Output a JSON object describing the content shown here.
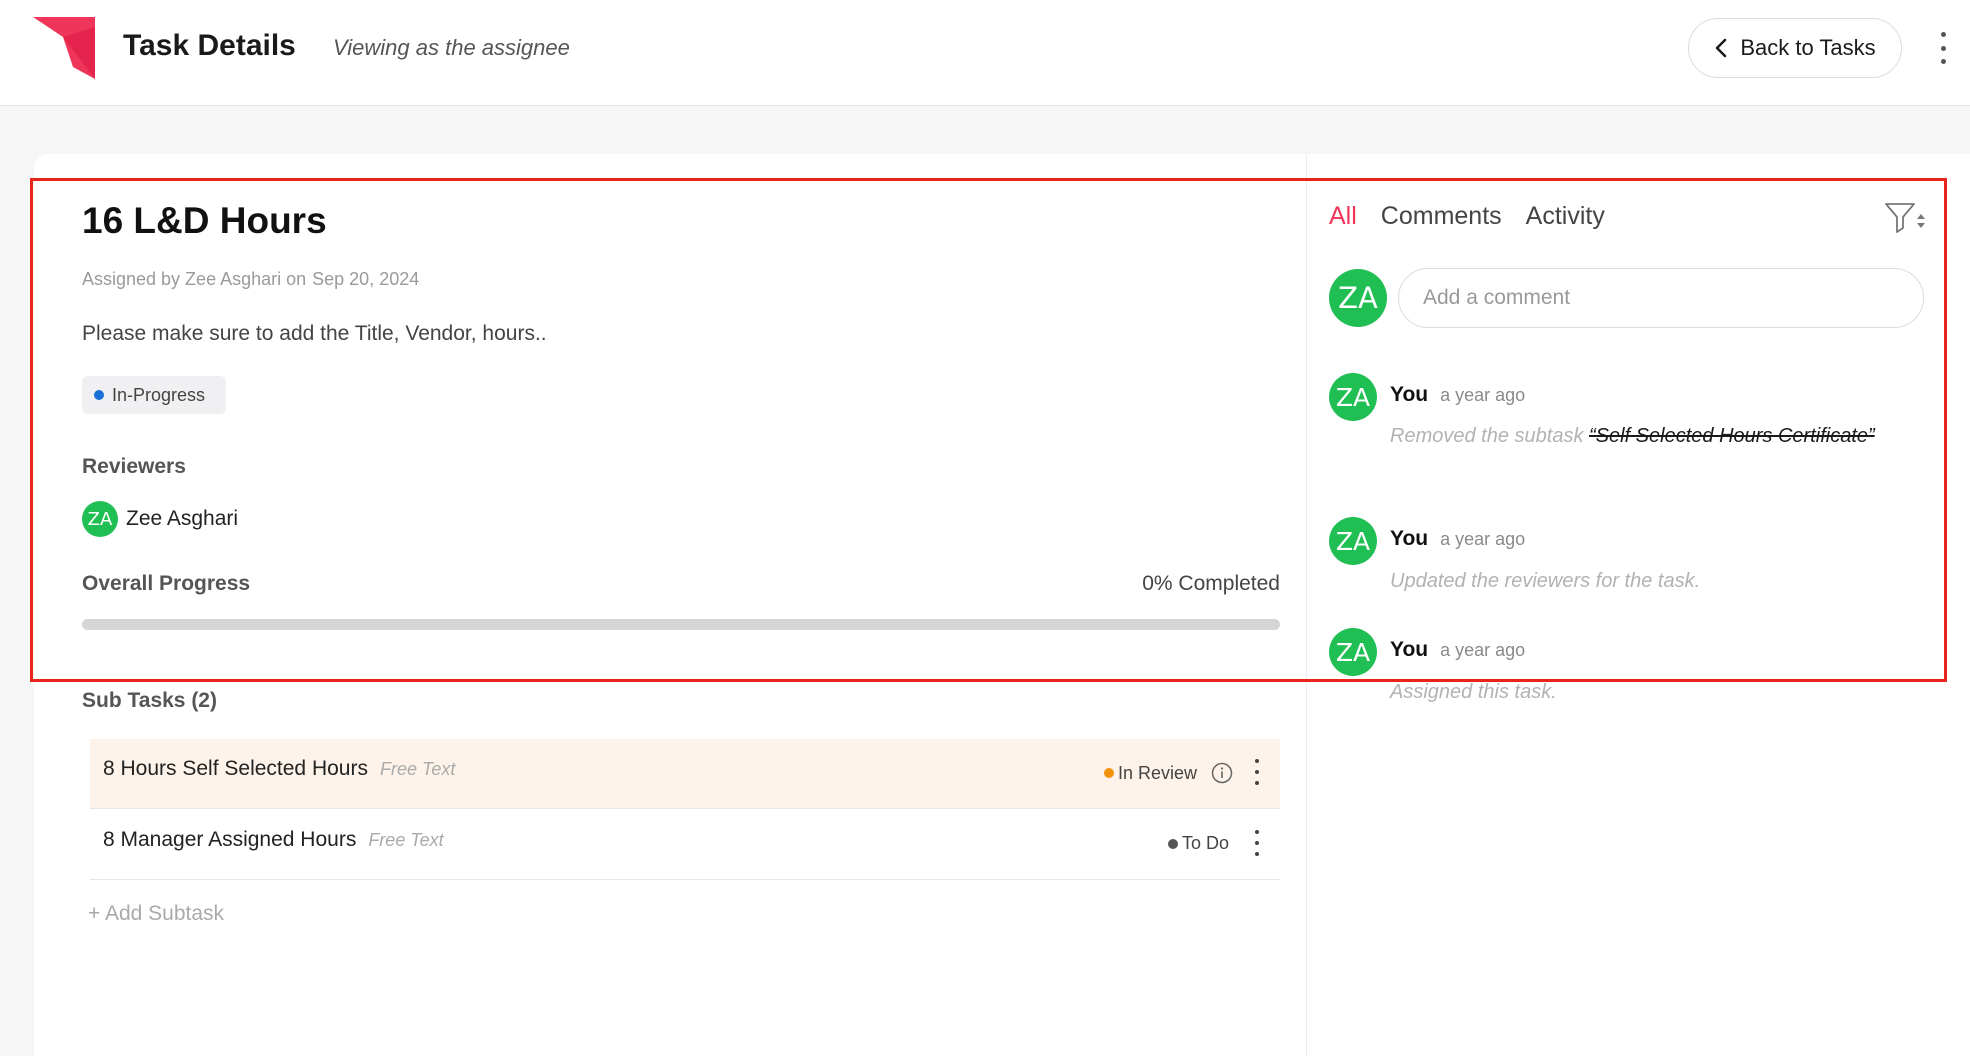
{
  "header": {
    "title": "Task Details",
    "subtitle": "Viewing as the assignee",
    "back_label": "Back to Tasks"
  },
  "task": {
    "title": "16 L&D Hours",
    "assigned_by": "Assigned by Zee Asghari on",
    "assigned_date": "Sep 20, 2024",
    "description": "Please make sure to add the Title, Vendor, hours..",
    "status": "In-Progress",
    "status_color": "#1a6fd6",
    "reviewers_label": "Reviewers",
    "reviewer": {
      "initials": "ZA",
      "name": "Zee Asghari"
    },
    "progress_label": "Overall Progress",
    "progress_text": "0% Completed",
    "progress_value": 0,
    "subtasks_label": "Sub Tasks (2)",
    "subtasks": [
      {
        "name": "8 Hours Self Selected Hours",
        "tag": "Free Text",
        "status": "In Review",
        "status_color": "#f2900c"
      },
      {
        "name": "8 Manager Assigned Hours",
        "tag": "Free Text",
        "status": "To Do",
        "status_color": "#555555"
      }
    ],
    "add_subtask": "+ Add Subtask"
  },
  "activity": {
    "tabs": [
      "All",
      "Comments",
      "Activity"
    ],
    "active_tab": "All",
    "composer_initials": "ZA",
    "comment_placeholder": "Add a comment",
    "items": [
      {
        "initials": "ZA",
        "user": "You",
        "time": "a year ago",
        "prefix": "Removed the subtask ",
        "strike": "“Self Selected Hours Certificate”"
      },
      {
        "initials": "ZA",
        "user": "You",
        "time": "a year ago",
        "message": "Updated the reviewers for the task."
      },
      {
        "initials": "ZA",
        "user": "You",
        "time": "a year ago",
        "message": "Assigned this task."
      }
    ]
  },
  "colors": {
    "brand": "#f0355a",
    "avatar": "#1fbf53",
    "annotation": "#e8251b"
  }
}
